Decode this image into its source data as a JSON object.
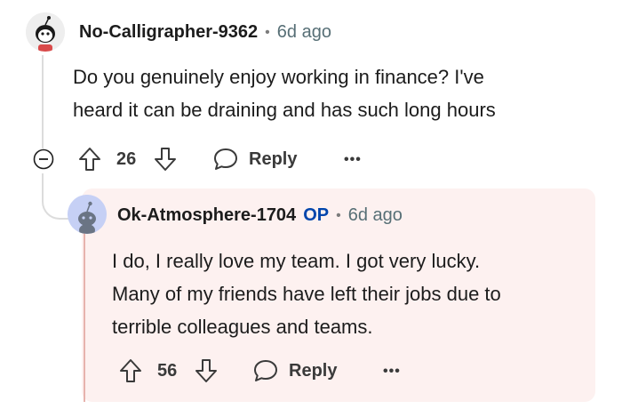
{
  "comment": {
    "username": "No-Calligrapher-9362",
    "separator": "•",
    "time": "6d ago",
    "body_line1": "Do you genuinely enjoy working in finance? I've",
    "body_line2": "heard it can be draining and has such long hours",
    "score": "26",
    "reply_label": "Reply",
    "more_label": "•••",
    "collapse_icon": "minus-circle-icon"
  },
  "reply": {
    "username": "Ok-Atmosphere-1704",
    "op_badge": "OP",
    "separator": "•",
    "time": "6d ago",
    "body_line1": "I do, I really love my team. I got very lucky.",
    "body_line2": "Many of my friends have left their jobs due to",
    "body_line3": "terrible colleagues and teams.",
    "score": "56",
    "reply_label": "Reply",
    "more_label": "•••"
  },
  "colors": {
    "highlight_bg": "#fdf1f0",
    "op_blue": "#0045ac",
    "meta_gray": "#576f76",
    "thread_line": "#dcdcdc"
  }
}
